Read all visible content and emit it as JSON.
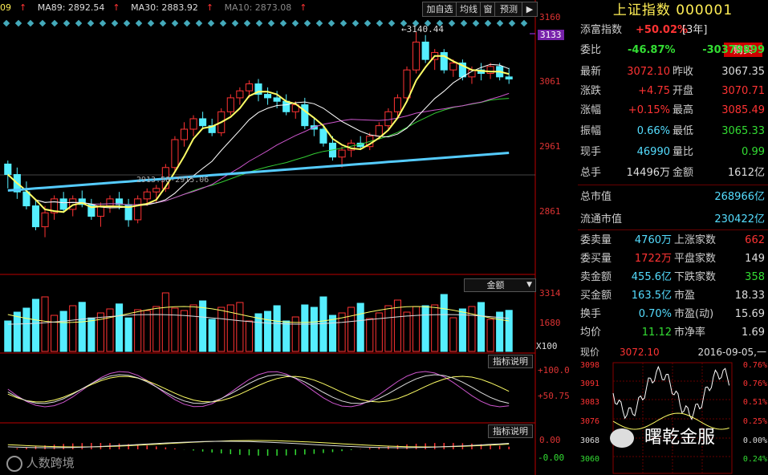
{
  "ma_bar": {
    "ma_first": "09",
    "ma89": "MA89: 2892.54",
    "ma30": "MA30: 2883.92",
    "ma10": "MA10: 2873.08"
  },
  "toolbar": {
    "add_watch": "加自选",
    "ma_line": "均线",
    "window": "窗",
    "forecast": "预测",
    "arrow": "▶"
  },
  "price_axis": [
    "3160",
    "3133",
    "3061",
    "2961",
    "2861"
  ],
  "annotations": {
    "high": "3140.44",
    "low": "2915.06",
    "low_prefix": "2913.58"
  },
  "volume_panel": {
    "selector": "金额",
    "axis": [
      "3314",
      "1680",
      "X100"
    ]
  },
  "indicator1": {
    "explain": "指标说明",
    "axis": [
      "+100.0",
      "+50.75"
    ]
  },
  "indicator2": {
    "explain": "指标说明",
    "axis": [
      "0.00",
      "-0.00"
    ]
  },
  "watermark": {
    "left": "人数跨境",
    "right": "曙乾金服"
  },
  "quote": {
    "title": "上证指数 000001",
    "subtitle_label": "添富指数",
    "subtitle_value": "+50.02%",
    "subtitle_period": "[3年]",
    "buy": "购买",
    "weibi_label": "委比",
    "weibi_pct": "-46.87%",
    "weibi_val": "-30379899",
    "latest_label": "最新",
    "latest": "3072.10",
    "prev_close_label": "昨收",
    "prev_close": "3067.35",
    "change_label": "涨跌",
    "change": "+4.75",
    "open_label": "开盘",
    "open": "3070.71",
    "pct_label": "涨幅",
    "pct": "+0.15%",
    "high_label": "最高",
    "high": "3085.49",
    "amp_label": "振幅",
    "amp": "0.66%",
    "low_label": "最低",
    "low": "3065.33",
    "hand_label": "现手",
    "hand": "46990",
    "ratio_label": "量比",
    "ratio": "0.99",
    "total_label": "总手",
    "total": "14496万",
    "amount_label": "金额",
    "amount": "1612亿",
    "mktcap_label": "总市值",
    "mktcap": "268966亿",
    "float_label": "流通市值",
    "float": "230422亿",
    "sell_vol_label": "委卖量",
    "sell_vol": "4760万",
    "up_count_label": "上涨家数",
    "up_count": "662",
    "buy_vol_label": "委买量",
    "buy_vol": "1722万",
    "flat_count_label": "平盘家数",
    "flat_count": "149",
    "sell_amt_label": "卖金额",
    "sell_amt": "455.6亿",
    "down_count_label": "下跌家数",
    "down_count": "358",
    "buy_amt_label": "买金额",
    "buy_amt": "163.5亿",
    "pe_label": "市盈",
    "pe": "18.33",
    "turnover_label": "换手",
    "turnover": "0.70%",
    "pe_dyn_label": "市盈(动)",
    "pe_dyn": "15.69",
    "avg_label": "均价",
    "avg": "11.12",
    "pb_label": "市净率",
    "pb": "1.69"
  },
  "mini_chart": {
    "label_now": "现价",
    "price": "3072.10",
    "date": "2016-09-05,一",
    "left_axis": [
      "3098",
      "3091",
      "3083",
      "3076",
      "3068",
      "3060"
    ],
    "right_axis": [
      "0.76%",
      "0.76%",
      "0.51%",
      "0.25%",
      "0.00%",
      "0.24%"
    ]
  },
  "colors": {
    "up": "#ff3333",
    "down": "#55eeff",
    "ma5": "#ffff66",
    "ma10": "#ffffff",
    "ma30": "#cc55cc",
    "ma60": "#33cc33",
    "ma89": "#55ccff"
  },
  "chart_data": {
    "type": "candlestick",
    "ylim": [
      2840,
      3160
    ],
    "candles": [
      [
        2950,
        2955,
        2915,
        2935
      ],
      [
        2935,
        2945,
        2900,
        2910
      ],
      [
        2910,
        2925,
        2885,
        2890
      ],
      [
        2890,
        2900,
        2855,
        2860
      ],
      [
        2860,
        2890,
        2845,
        2880
      ],
      [
        2880,
        2905,
        2870,
        2900
      ],
      [
        2900,
        2910,
        2880,
        2885
      ],
      [
        2885,
        2905,
        2875,
        2900
      ],
      [
        2900,
        2912,
        2888,
        2892
      ],
      [
        2892,
        2900,
        2870,
        2875
      ],
      [
        2875,
        2895,
        2860,
        2890
      ],
      [
        2890,
        2905,
        2880,
        2900
      ],
      [
        2900,
        2910,
        2885,
        2892
      ],
      [
        2892,
        2900,
        2860,
        2870
      ],
      [
        2870,
        2905,
        2865,
        2900
      ],
      [
        2900,
        2915,
        2890,
        2910
      ],
      [
        2910,
        2920,
        2895,
        2915
      ],
      [
        2915,
        2950,
        2910,
        2945
      ],
      [
        2945,
        2990,
        2940,
        2985
      ],
      [
        2985,
        3010,
        2975,
        3000
      ],
      [
        3000,
        3020,
        2990,
        3015
      ],
      [
        3015,
        3025,
        3000,
        3005
      ],
      [
        3005,
        3015,
        2990,
        2995
      ],
      [
        2995,
        3030,
        2990,
        3025
      ],
      [
        3025,
        3050,
        3020,
        3045
      ],
      [
        3045,
        3060,
        3035,
        3055
      ],
      [
        3055,
        3070,
        3045,
        3065
      ],
      [
        3065,
        3072,
        3040,
        3050
      ],
      [
        3050,
        3060,
        3035,
        3045
      ],
      [
        3045,
        3055,
        3030,
        3040
      ],
      [
        3040,
        3050,
        3020,
        3025
      ],
      [
        3025,
        3040,
        3015,
        3035
      ],
      [
        3035,
        3045,
        3000,
        3005
      ],
      [
        3005,
        3015,
        2990,
        3000
      ],
      [
        3000,
        3005,
        2975,
        2980
      ],
      [
        2980,
        2990,
        2955,
        2960
      ],
      [
        2960,
        2975,
        2945,
        2970
      ],
      [
        2970,
        2985,
        2960,
        2980
      ],
      [
        2980,
        2990,
        2970,
        2975
      ],
      [
        2975,
        2995,
        2970,
        2990
      ],
      [
        2990,
        3010,
        2985,
        3005
      ],
      [
        3005,
        3030,
        3000,
        3025
      ],
      [
        3025,
        3050,
        3015,
        3045
      ],
      [
        3045,
        3090,
        3040,
        3085
      ],
      [
        3085,
        3140,
        3080,
        3125
      ],
      [
        3125,
        3135,
        3095,
        3100
      ],
      [
        3100,
        3115,
        3085,
        3110
      ],
      [
        3110,
        3115,
        3080,
        3085
      ],
      [
        3085,
        3100,
        3075,
        3095
      ],
      [
        3095,
        3100,
        3070,
        3075
      ],
      [
        3075,
        3090,
        3065,
        3085
      ],
      [
        3085,
        3095,
        3070,
        3080
      ],
      [
        3080,
        3095,
        3072,
        3090
      ],
      [
        3090,
        3095,
        3070,
        3075
      ],
      [
        3075,
        3088,
        3065,
        3072
      ]
    ]
  }
}
